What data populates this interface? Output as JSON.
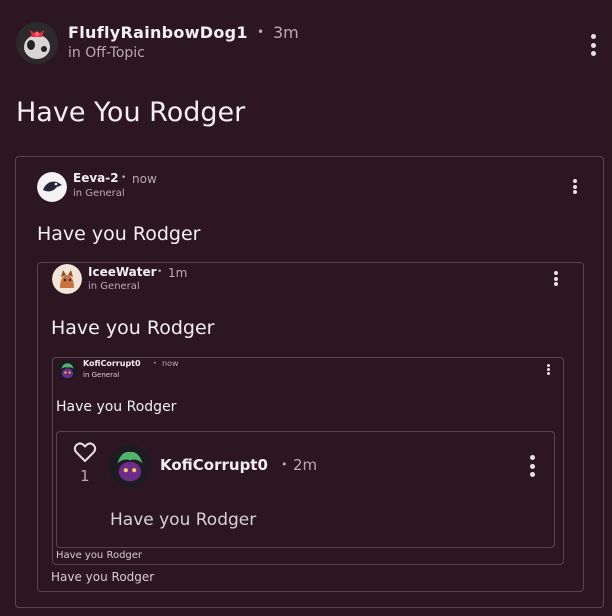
{
  "post": {
    "author": "FluflyRainbowDog1",
    "separator": "•",
    "time": "3m",
    "location": "in Off-Topic",
    "title": "Have You Rodger"
  },
  "quote1": {
    "author": "Eeva-2",
    "separator": "•",
    "time": "now",
    "location": "in General",
    "text": "Have you Rodger"
  },
  "quote2": {
    "author": "IceeWater",
    "separator": "•",
    "time": "1m",
    "location": "in General",
    "text": "Have you Rodger",
    "footer": "Have you Rodger"
  },
  "quote3": {
    "author": "KofiCorrupt0",
    "separator": "•",
    "time": "now",
    "location": "in General",
    "text": "Have you Rodger",
    "footer": "Have you Rodger"
  },
  "comment": {
    "author": "KofiCorrupt0",
    "separator": "•",
    "time": "2m",
    "text": "Have you Rodger",
    "like_count": "1"
  },
  "icons": {
    "like": "heart-outline-icon",
    "menu": "vertical-dots-icon"
  },
  "colors": {
    "background": "#2b1622",
    "border": "#5a4450",
    "text": "#f3eef2",
    "muted": "#b9aab3"
  }
}
